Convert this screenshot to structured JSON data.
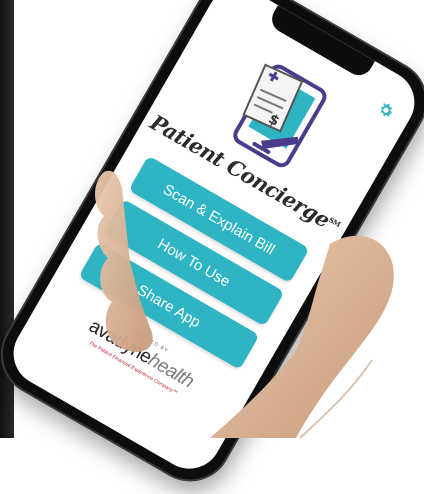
{
  "app": {
    "name": "Patient Concierge",
    "service_mark": "SM"
  },
  "buttons": {
    "scan": "Scan & Explain Bill",
    "how_to_use": "How To Use",
    "share_app": "Share App"
  },
  "icons": {
    "settings": "gear-icon",
    "logo": "phone-with-bill-icon"
  },
  "footer": {
    "powered_by": "POWERED BY",
    "company_word": "avadyne",
    "company_health": "health",
    "tagline": "The Patient Financial Experience Company™"
  },
  "colors": {
    "accent": "#2fb4c4",
    "logo_purple": "#4a3b8c",
    "tagline_red": "#c4262e"
  }
}
